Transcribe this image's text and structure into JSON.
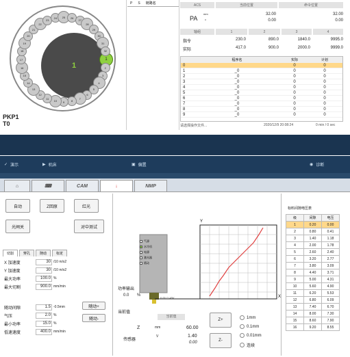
{
  "head": {
    "station": "PKP1",
    "tool": "T0",
    "center_number": "1",
    "active_slot": "1",
    "slot_labels": [
      "1",
      "2",
      "3",
      "4",
      "5",
      "6",
      "7",
      "8",
      "9",
      "10",
      "11",
      "12",
      "13",
      "14",
      "15",
      "16",
      "17",
      "18",
      "19",
      "20",
      "21",
      "22",
      "23",
      "24",
      "25",
      "26",
      "27",
      "28",
      "29",
      "30",
      "31",
      "32"
    ]
  },
  "list_column": {
    "col1": "P",
    "col2": "S",
    "col3": "链路名"
  },
  "axes_panel": {
    "acs_label": "ACS",
    "current_pos_label": "当前位置",
    "cmd_pos_label": "命令位置",
    "pa_label": "PA",
    "pa_unit_top": "mm",
    "pa_unit_bot": "°",
    "pa_current": [
      "32.00",
      "0.00"
    ],
    "pa_command": [
      "32.00",
      "0.00"
    ],
    "axis_hdr_label": "轴组",
    "axis_numbers": [
      "1",
      "2",
      "3",
      "4"
    ],
    "cmd_label": "指令",
    "actual_label": "实际",
    "cmd_values": [
      "230.0",
      "890.0",
      "1840.0",
      "9995.0"
    ],
    "actual_values": [
      "417.0",
      "900.0",
      "2000.0",
      "9999.0"
    ]
  },
  "program_table": {
    "headers": [
      "",
      "程序名",
      "实际",
      "计划"
    ],
    "rows": [
      {
        "idx": "0",
        "name": "",
        "actual": "0",
        "plan": "0"
      },
      {
        "idx": "1",
        "name": "_0",
        "actual": "0",
        "plan": "0"
      },
      {
        "idx": "2",
        "name": "_0",
        "actual": "0",
        "plan": "0"
      },
      {
        "idx": "3",
        "name": "_0",
        "actual": "0",
        "plan": "0"
      },
      {
        "idx": "4",
        "name": "_0",
        "actual": "0",
        "plan": "0"
      },
      {
        "idx": "5",
        "name": "_0",
        "actual": "0",
        "plan": "0"
      },
      {
        "idx": "6",
        "name": "_0",
        "actual": "0",
        "plan": "0"
      },
      {
        "idx": "7",
        "name": "_0",
        "actual": "0",
        "plan": "0"
      },
      {
        "idx": "8",
        "name": "_0",
        "actual": "0",
        "plan": "0"
      },
      {
        "idx": "9",
        "name": "_0",
        "actual": "0",
        "plan": "0"
      }
    ]
  },
  "status_bar": {
    "message": "请选择操作文件...",
    "datetime": "2020/12/9 20:08:24",
    "timer": "0 min / 0 sec"
  },
  "navbar": {
    "item1": "演示",
    "item2": "机床",
    "item3": "偏置",
    "item4": "诊断"
  },
  "tabs": {
    "home": "⌂",
    "keyboard": "⌨",
    "cam": "CAM",
    "arrow": "↓",
    "nmp": "NMP"
  },
  "control": {
    "btn_auto": "自动",
    "btn_zreset": "Z回原",
    "btn_redlight": "红光",
    "btn_shutter": "光闸关",
    "btn_center_test": "对中测试",
    "subtabs": [
      "切割",
      "穿孔",
      "随动",
      "标定"
    ],
    "params": [
      {
        "label": "X 加速度",
        "value": "30",
        "unit": "/10 m/s2"
      },
      {
        "label": "Y 加速度",
        "value": "30",
        "unit": "/10 m/s2"
      },
      {
        "label": "最大功率",
        "value": "100.0",
        "unit": "%"
      },
      {
        "label": "最大切割",
        "value": "900.0",
        "unit": "mm/min"
      },
      {
        "label": "随动间隙",
        "value": "1.5",
        "unit": "-0.5mm"
      },
      {
        "label": "气压",
        "value": "2.0",
        "unit": "%"
      },
      {
        "label": "最小功率",
        "value": "15.0",
        "unit": "%"
      },
      {
        "label": "低速速度",
        "value": "400.0",
        "unit": "mm/min"
      }
    ],
    "btn_follow": "随动+",
    "btn_follow_minus": "随动-"
  },
  "center": {
    "legend_items": [
      "气源",
      "水冷机",
      "电源",
      "激光器",
      "随动"
    ],
    "power_label": "功率输出",
    "power_value": "0.0",
    "power_unit": "%",
    "pos_label": "当前值",
    "pos_hdr": "当前值",
    "z_label": "Z",
    "z_unit": "mm",
    "z_value": "60.00",
    "sensor_label": "传感器",
    "sensor_unit": "V",
    "sensor_value": "1.40",
    "sensor_value2": "0.00",
    "zplus": "Z+",
    "zminus": "Z-",
    "step_options": [
      "1mm",
      "0.1mm",
      "0.01mm",
      "连续"
    ],
    "graph_y": "Y",
    "graph_x": "X",
    "gauge_text": "0.00 /1.45V"
  },
  "sensor_table": {
    "title": "标料间隙电压表",
    "headers": [
      "级",
      "间隙",
      "电压"
    ],
    "rows": [
      [
        "1",
        "0.20",
        "0.00"
      ],
      [
        "2",
        "0.80",
        "0.41"
      ],
      [
        "3",
        "1.40",
        "1.18"
      ],
      [
        "4",
        "2.00",
        "1.78"
      ],
      [
        "5",
        "2.60",
        "2.40"
      ],
      [
        "6",
        "3.20",
        "2.77"
      ],
      [
        "7",
        "3.80",
        "3.09"
      ],
      [
        "8",
        "4.40",
        "3.71"
      ],
      [
        "9",
        "5.00",
        "4.31"
      ],
      [
        "10",
        "5.60",
        "4.90"
      ],
      [
        "11",
        "6.20",
        "5.53"
      ],
      [
        "12",
        "6.80",
        "6.09"
      ],
      [
        "13",
        "7.40",
        "6.70"
      ],
      [
        "14",
        "8.00",
        "7.30"
      ],
      [
        "15",
        "8.60",
        "7.90"
      ],
      [
        "16",
        "9.20",
        "8.55"
      ]
    ]
  },
  "colors": {
    "accent_green": "#8fd13f",
    "dark_band": "#1a3450",
    "selected_row": "#ffd88a",
    "curve_red": "#e04040"
  }
}
